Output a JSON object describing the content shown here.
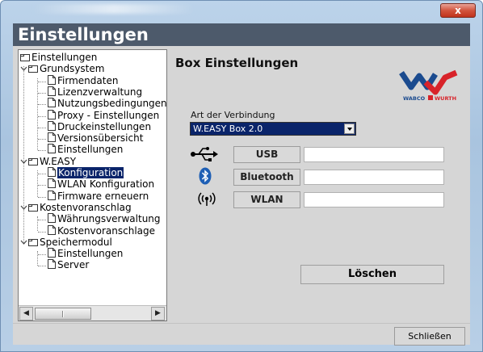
{
  "window": {
    "close_glyph": "x"
  },
  "header": {
    "title": "Einstellungen"
  },
  "tree": {
    "nodes": [
      {
        "label": "Einstellungen"
      },
      {
        "label": "Grundsystem"
      },
      {
        "label": "Firmendaten"
      },
      {
        "label": "Lizenzverwaltung"
      },
      {
        "label": "Nutzungsbedingungen"
      },
      {
        "label": "Proxy - Einstellungen"
      },
      {
        "label": "Druckeinstellungen"
      },
      {
        "label": "Versionsübersicht"
      },
      {
        "label": "Einstellungen"
      },
      {
        "label": "W.EASY"
      },
      {
        "label": "Konfiguration"
      },
      {
        "label": "WLAN Konfiguration"
      },
      {
        "label": "Firmware erneuern"
      },
      {
        "label": "Kostenvoranschlag"
      },
      {
        "label": "Währungsverwaltung"
      },
      {
        "label": "Kostenvoranschlage"
      },
      {
        "label": "Speichermodul"
      },
      {
        "label": "Einstellungen"
      },
      {
        "label": "Server"
      }
    ],
    "scrollbar": {
      "left_glyph": "◀",
      "right_glyph": "▶"
    }
  },
  "panel": {
    "title": "Box Einstellungen",
    "logo_text_left": "WABCO",
    "logo_text_right": "WURTH",
    "connection_label": "Art der Verbindung",
    "connection_value": "W.EASY Box 2.0",
    "usb_label": "USB",
    "bluetooth_label": "Bluetooth",
    "wlan_label": "WLAN",
    "delete_label": "Löschen"
  },
  "footer": {
    "close_label": "Schließen"
  },
  "colors": {
    "header_bg": "#4d5a6b",
    "selection_bg": "#0a246a",
    "bluetooth_blue": "#1e5fb5",
    "logo_blue": "#1b4b8f",
    "logo_red": "#d8232a"
  },
  "icons": {
    "usb": "usb-icon",
    "bluetooth": "bluetooth-icon",
    "wlan": "wlan-icon",
    "folder": "folder-icon",
    "page": "page-icon"
  }
}
